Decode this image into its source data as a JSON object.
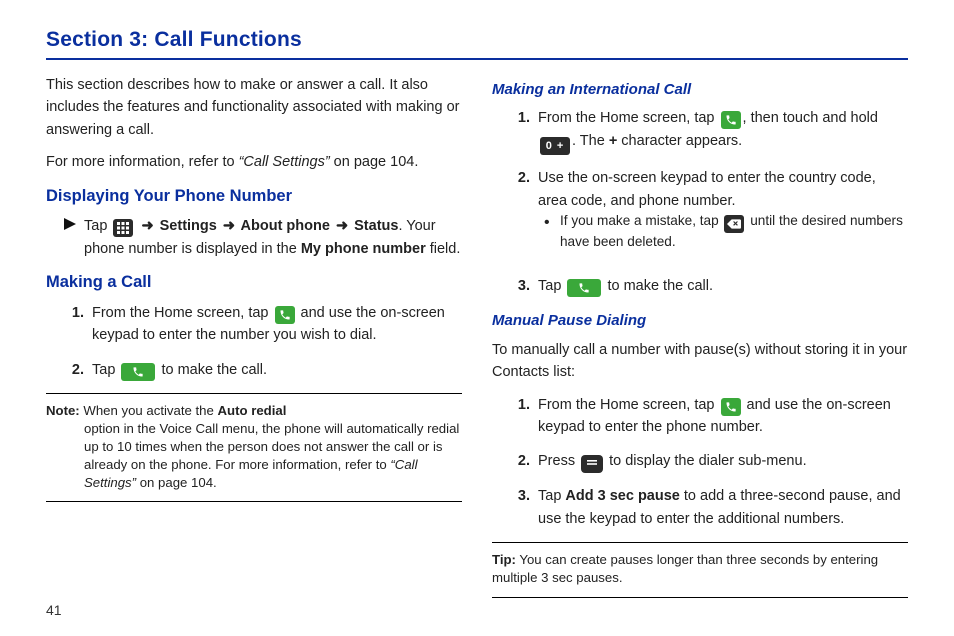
{
  "page_number": "41",
  "section_title": "Section 3: Call Functions",
  "left": {
    "intro": "This section describes how to make or answer a call. It also includes the features and functionality associated with making or answering a call.",
    "crossref_prefix": "For more information, refer to ",
    "crossref_link": "“Call Settings”",
    "crossref_suffix": "  on page 104.",
    "h_display": "Displaying Your Phone Number",
    "display_row": {
      "pre": "Tap ",
      "arrow": "➜",
      "settings": " Settings ",
      "about": " About phone ",
      "status": " Status",
      "post1": ". Your phone number is displayed in the ",
      "field": "My phone number",
      "post2": " field."
    },
    "h_make": "Making a Call",
    "make_steps": {
      "s1_pre": "From the Home screen, tap ",
      "s1_post": " and use the on-screen keypad to enter the number you wish to dial.",
      "s2_pre": "Tap ",
      "s2_post": " to make the call."
    },
    "note": {
      "label": "Note:",
      "line1": " When you activate the ",
      "autoredial": "Auto redial",
      "line2": " option in the Voice Call menu, the phone will automatically redial up to 10 times when the person does not answer the call or is already on the phone. For more information, refer to ",
      "ref": "“Call Settings”",
      "line3": "  on page 104."
    }
  },
  "right": {
    "h_intl": "Making an International Call",
    "intl_steps": {
      "s1_pre": "From the Home screen, tap ",
      "s1_mid": ", then touch and hold ",
      "s1_zero": "0 +",
      "s1_post1": ". The ",
      "s1_plus": "+",
      "s1_post2": " character appears.",
      "s2": "Use the on-screen keypad to enter the country code, area code, and phone number.",
      "s2_bullet_pre": "If you make a mistake, tap ",
      "s2_bullet_post": " until the desired numbers have been deleted.",
      "s3_pre": "Tap ",
      "s3_post": " to make the call."
    },
    "h_pause": "Manual Pause Dialing",
    "pause_intro": "To manually call a number with pause(s) without storing it in your Contacts list:",
    "pause_steps": {
      "s1_pre": "From the Home screen, tap ",
      "s1_post": " and use the on-screen keypad to enter the phone number.",
      "s2_pre": "Press ",
      "s2_post": " to display the dialer sub-menu.",
      "s3_pre": "Tap ",
      "s3_bold": "Add 3 sec pause",
      "s3_post": " to add a three-second pause, and use the keypad to enter the additional numbers."
    },
    "tip": {
      "label": "Tip:",
      "body": " You can create pauses longer than three seconds by entering multiple 3 sec pauses."
    }
  }
}
